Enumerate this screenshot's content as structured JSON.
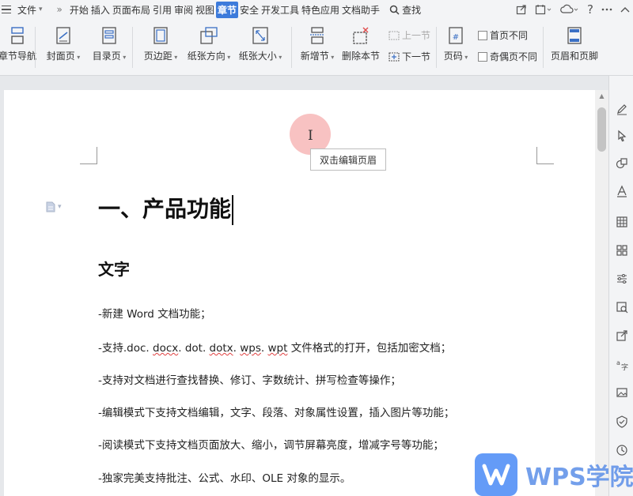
{
  "menubar": {
    "file_label": "文件",
    "tabs": [
      "开始",
      "插入",
      "页面布局",
      "引用",
      "审阅",
      "视图",
      "章节",
      "安全",
      "开发工具",
      "特色应用",
      "文档助手"
    ],
    "active_tab": "章节",
    "search_label": "查找"
  },
  "ribbon": {
    "section_nav": "章节导航",
    "cover": "封面页",
    "toc": "目录页",
    "margins": "页边距",
    "orientation": "纸张方向",
    "size": "纸张大小",
    "new_section": "新增节",
    "delete_section": "删除本节",
    "prev_section": "上一节",
    "next_section": "下一节",
    "page_number": "页码",
    "first_page_diff": "首页不同",
    "odd_even_diff": "奇偶页不同",
    "header_footer": "页眉和页脚"
  },
  "document": {
    "tooltip": "双击编辑页眉",
    "heading1": "一、产品功能",
    "heading2": "文字",
    "para1": "-新建 Word 文档功能；",
    "para2_pre": "-支持.doc. ",
    "para2_docx": "docx",
    "para2_mid1": ". dot. ",
    "para2_dotx": "dotx",
    "para2_mid2": ". ",
    "para2_wps": "wps",
    "para2_mid3": ". ",
    "para2_wpt": "wpt",
    "para2_post": " 文件格式的打开，包括加密文档；",
    "para3": "-支持对文档进行查找替换、修订、字数统计、拼写检查等操作；",
    "para4": "-编辑模式下支持文档编辑，文字、段落、对象属性设置，插入图片等功能；",
    "para5": "-阅读模式下支持文档页面放大、缩小，调节屏幕亮度，增减字号等功能；",
    "para6": "-独家完美支持批注、公式、水印、OLE 对象的显示。"
  },
  "watermark": {
    "brand": "WPS学院"
  },
  "colors": {
    "accent": "#3d7bdb",
    "watermark": "#5b8fe8"
  }
}
